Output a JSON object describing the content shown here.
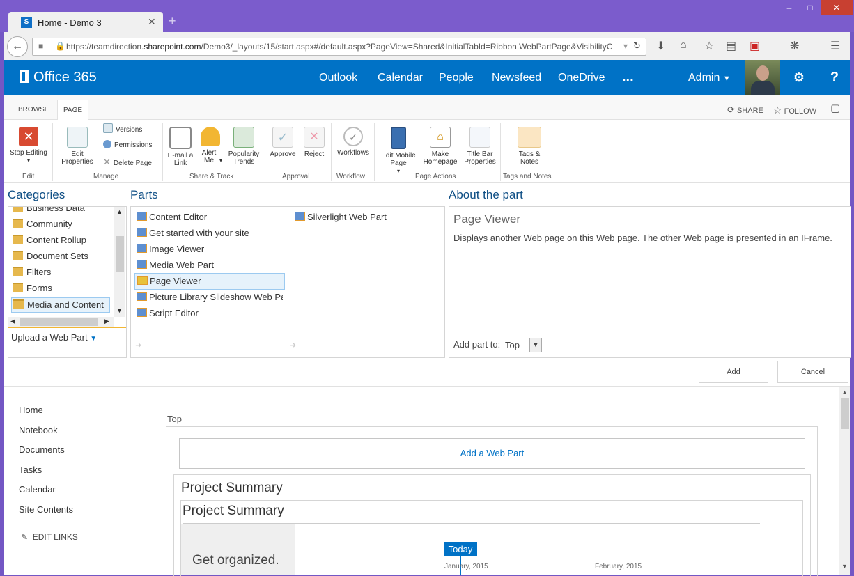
{
  "browser": {
    "tab_title": "Home - Demo 3",
    "tab_favicon": "S",
    "url_prefix": "https://teamdirection.",
    "url_domain": "sharepoint.com",
    "url_rest": "/Demo3/_layouts/15/start.aspx#/default.aspx?PageView=Shared&InitialTabId=Ribbon.WebPartPage&VisibilityC"
  },
  "suite": {
    "brand": "Office 365",
    "links": [
      "Outlook",
      "Calendar",
      "People",
      "Newsfeed",
      "OneDrive",
      "..."
    ],
    "user": "Admin"
  },
  "ribbon": {
    "tabs": [
      "BROWSE",
      "PAGE"
    ],
    "share": "SHARE",
    "follow": "FOLLOW",
    "stop_editing": "Stop Editing",
    "edit_properties": "Edit Properties",
    "versions": "Versions",
    "permissions": "Permissions",
    "delete_page": "Delete Page",
    "email_link": "E-mail a Link",
    "alert_me": "Alert Me",
    "popularity": "Popularity Trends",
    "approve": "Approve",
    "reject": "Reject",
    "workflows": "Workflows",
    "edit_mobile": "Edit Mobile Page",
    "make_homepage": "Make Homepage",
    "title_bar": "Title Bar Properties",
    "tags_notes": "Tags & Notes",
    "groups": [
      "Edit",
      "Manage",
      "Share & Track",
      "Approval",
      "Workflow",
      "Page Actions",
      "Tags and Notes"
    ]
  },
  "adder": {
    "categories_title": "Categories",
    "parts_title": "Parts",
    "about_title": "About the part",
    "categories": [
      "Business Data",
      "Community",
      "Content Rollup",
      "Document Sets",
      "Filters",
      "Forms",
      "Media and Content"
    ],
    "selected_category": "Media and Content",
    "upload": "Upload a Web Part",
    "parts_col1": [
      "Content Editor",
      "Get started with your site",
      "Image Viewer",
      "Media Web Part",
      "Page Viewer",
      "Picture Library Slideshow Web Part",
      "Script Editor"
    ],
    "parts_col2": [
      "Silverlight Web Part"
    ],
    "selected_part": "Page Viewer",
    "about_name": "Page Viewer",
    "about_desc": "Displays another Web page on this Web page. The other Web page is presented in an IFrame.",
    "add_part_to_label": "Add part to:",
    "add_part_to_value": "Top",
    "add_button": "Add",
    "cancel_button": "Cancel"
  },
  "quicklaunch": [
    "Home",
    "Notebook",
    "Documents",
    "Tasks",
    "Calendar",
    "Site Contents"
  ],
  "edit_links": "EDIT LINKS",
  "content": {
    "zone_label": "Top",
    "add_web_part": "Add a Web Part",
    "project_summary_outer": "Project Summary",
    "project_summary_inner": "Project Summary",
    "get_organized": "Get organized.",
    "today": "Today",
    "month1": "January, 2015",
    "month2": "February, 2015"
  }
}
